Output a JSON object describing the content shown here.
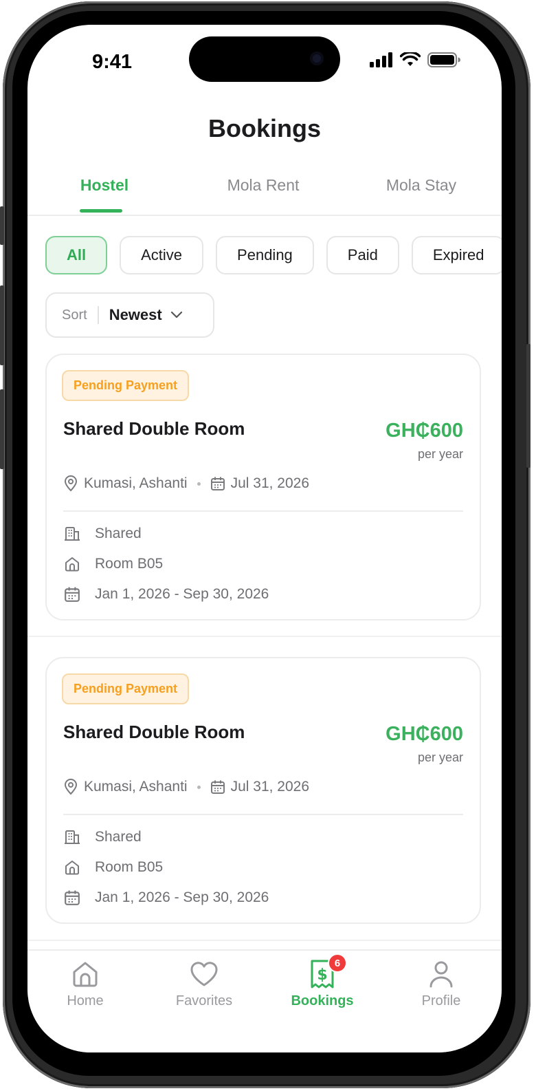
{
  "status_bar": {
    "time": "9:41"
  },
  "header": {
    "title": "Bookings"
  },
  "tabs": [
    {
      "label": "Hostel",
      "active": true
    },
    {
      "label": "Mola Rent",
      "active": false
    },
    {
      "label": "Mola Stay",
      "active": false
    }
  ],
  "filters": [
    {
      "label": "All",
      "active": true
    },
    {
      "label": "Active",
      "active": false
    },
    {
      "label": "Pending",
      "active": false
    },
    {
      "label": "Paid",
      "active": false
    },
    {
      "label": "Expired",
      "active": false
    }
  ],
  "sort": {
    "label": "Sort",
    "value": "Newest"
  },
  "bookings": [
    {
      "status": "Pending Payment",
      "title": "Shared Double Room",
      "price": "GH₵600",
      "period": "per year",
      "location": "Kumasi, Ashanti",
      "date": "Jul 31, 2026",
      "room_type": "Shared",
      "room": "Room B05",
      "date_range": "Jan 1, 2026 - Sep 30, 2026"
    },
    {
      "status": "Pending Payment",
      "title": "Shared Double Room",
      "price": "GH₵600",
      "period": "per year",
      "location": "Kumasi, Ashanti",
      "date": "Jul 31, 2026",
      "room_type": "Shared",
      "room": "Room B05",
      "date_range": "Jan 1, 2026 - Sep 30, 2026"
    }
  ],
  "bottom_nav": [
    {
      "label": "Home",
      "icon": "home-icon",
      "active": false
    },
    {
      "label": "Favorites",
      "icon": "heart-icon",
      "active": false
    },
    {
      "label": "Bookings",
      "icon": "receipt-icon",
      "active": true,
      "badge": "6"
    },
    {
      "label": "Profile",
      "icon": "user-icon",
      "active": false
    }
  ],
  "colors": {
    "accent": "#34b25a",
    "warning": "#f5a020",
    "badge": "#ef3b3b"
  }
}
